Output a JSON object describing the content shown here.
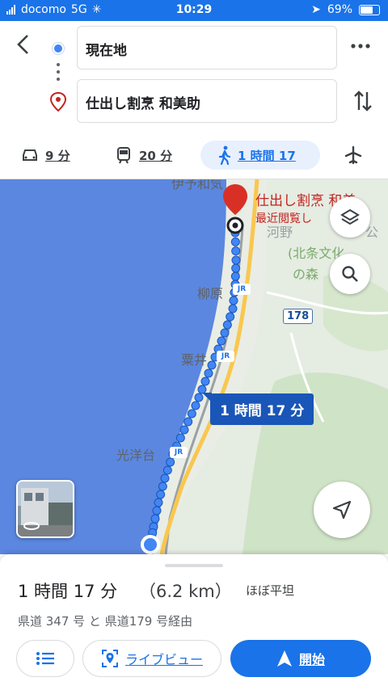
{
  "status_bar": {
    "carrier": "docomo",
    "network": "5G",
    "time": "10:29",
    "battery": "69%",
    "battery_level": 0.69
  },
  "header": {
    "origin": "現在地",
    "destination": "仕出し割烹 和美助"
  },
  "modes": [
    {
      "name": "car",
      "label": "9 分"
    },
    {
      "name": "transit",
      "label": "20 分"
    },
    {
      "name": "walk",
      "label": "1 時間 17"
    },
    {
      "name": "flight",
      "label": ""
    }
  ],
  "map": {
    "destination_label": "仕出し割烹 和美",
    "destination_sub": "最近閲覧し",
    "route_badge": "1 時間 17 分",
    "road_number": "178",
    "places": [
      "柳原",
      "粟井",
      "光洋台",
      "(北条文化",
      "の森",
      "河野",
      "公"
    ],
    "top_label": "伊予和気",
    "jr": "JR"
  },
  "sheet": {
    "duration": "1 時間 17 分",
    "distance": "（6.2 km）",
    "terrain": "ほぼ平坦",
    "via": "県道 347 号 と 県道179 号経由",
    "live_view": "ライブビュー",
    "start": "開始"
  },
  "colors": {
    "accent": "#1a73e8",
    "sea": "#5b87e0",
    "route": "#4285f4",
    "dest_red": "#c5221f"
  }
}
